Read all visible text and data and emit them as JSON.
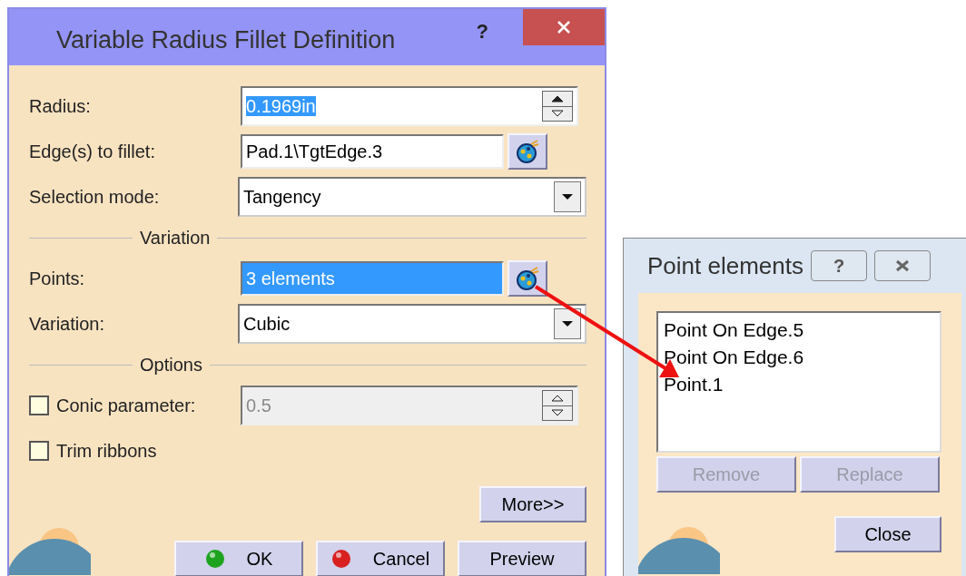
{
  "dialog": {
    "title": "Variable Radius Fillet Definition",
    "help": "?",
    "rows": [
      {
        "kind": "spinner",
        "label": "Radius:",
        "value": "0.1969in",
        "highlighted": true,
        "disabled": false
      },
      {
        "kind": "picker",
        "label": "Edge(s) to fillet:",
        "value": "Pad.1\\TgtEdge.3",
        "highlighted": false
      },
      {
        "kind": "dropdown",
        "label": "Selection mode:",
        "value": "Tangency"
      },
      {
        "kind": "separator",
        "label": "Variation"
      },
      {
        "kind": "picker",
        "label": "Points:",
        "value": "3 elements",
        "highlighted": true
      },
      {
        "kind": "dropdown",
        "label": "Variation:",
        "value": "Cubic"
      },
      {
        "kind": "separator",
        "label": "Options"
      },
      {
        "kind": "spinner",
        "label": "Conic parameter:",
        "value": "0.5",
        "highlighted": false,
        "disabled": true,
        "checked": false
      },
      {
        "kind": "checkbox",
        "label": "Trim ribbons",
        "checked": false
      }
    ],
    "more": "More>>",
    "buttons": [
      {
        "kind": "ok",
        "label": "OK"
      },
      {
        "kind": "cancel",
        "label": "Cancel"
      },
      {
        "kind": "plain",
        "label": "Preview"
      }
    ]
  },
  "point_window": {
    "title": "Point elements",
    "help": "?",
    "items": [
      {
        "label": "Point On Edge.5",
        "selected": false
      },
      {
        "label": "Point On Edge.6",
        "selected": false
      },
      {
        "label": "Point.1",
        "selected": false
      }
    ],
    "actions": [
      {
        "label": "Remove",
        "disabled": true
      },
      {
        "label": "Replace",
        "disabled": true
      }
    ],
    "close": {
      "label": "Close",
      "disabled": false
    }
  }
}
